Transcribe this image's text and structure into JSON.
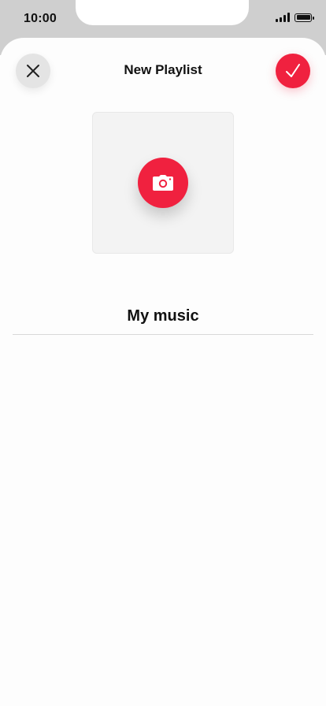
{
  "status_bar": {
    "time": "10:00",
    "signal_icon": "cellular-signal-icon",
    "battery_icon": "battery-icon"
  },
  "header": {
    "title": "New Playlist",
    "close_icon": "close-icon",
    "done_icon": "checkmark-icon"
  },
  "artwork": {
    "camera_icon": "camera-icon"
  },
  "playlist": {
    "name": "My music"
  },
  "colors": {
    "accent": "#f0213f",
    "close_button_bg": "#e4e4e4",
    "artwork_bg": "#f3f3f3"
  }
}
